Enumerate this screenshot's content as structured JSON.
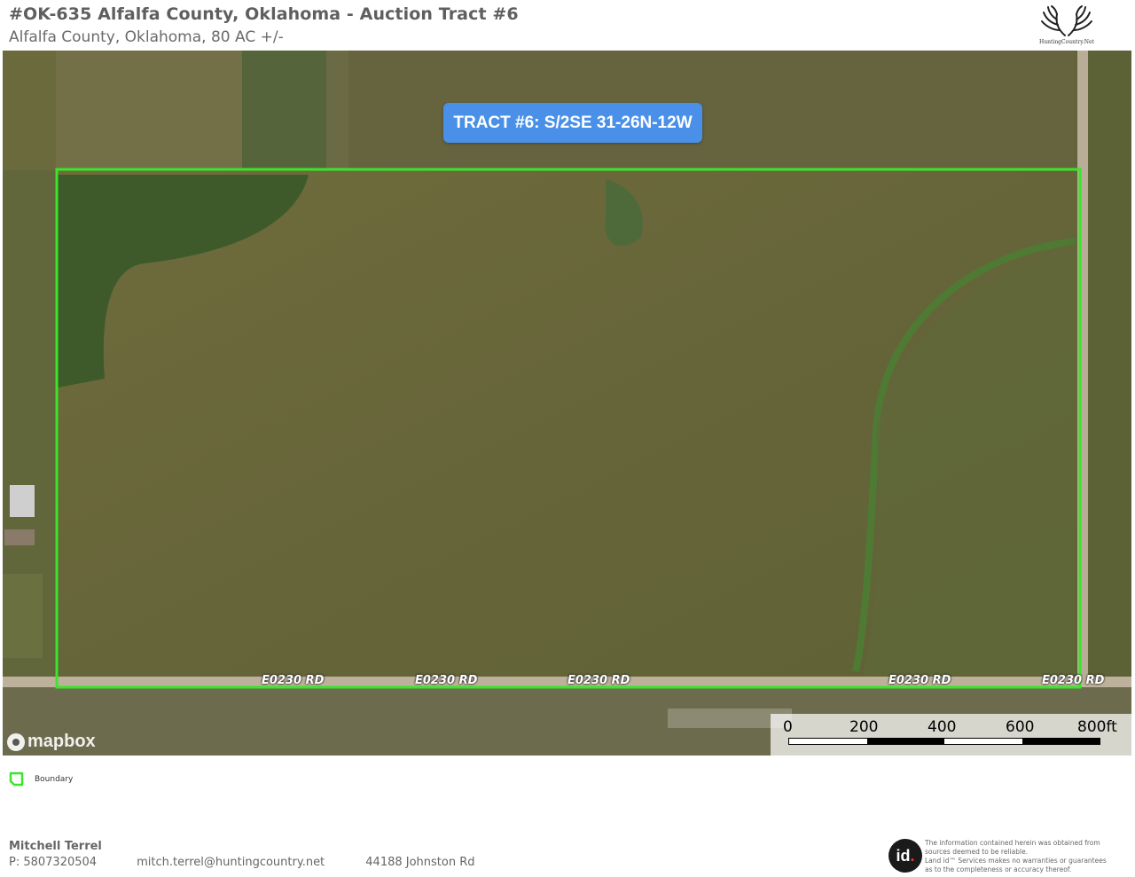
{
  "header": {
    "title": "#OK-635 Alfalfa County, Oklahoma - Auction Tract #6",
    "subtitle": "Alfalfa County, Oklahoma, 80 AC +/-"
  },
  "logo": {
    "text": "HuntingCountry.Net",
    "icon": "antlers-icon"
  },
  "map": {
    "tract_label": "TRACT #6: S/2SE 31-26N-12W",
    "road_labels": [
      "E0230 RD",
      "E0230 RD",
      "E0230 RD",
      "E0230 RD",
      "E0230 RD"
    ],
    "attribution": "mapbox",
    "boundary_color": "#39e62a",
    "scale": {
      "ticks": [
        "0",
        "200",
        "400",
        "600",
        "800ft"
      ]
    }
  },
  "legend": {
    "items": [
      {
        "label": "Boundary",
        "icon": "boundary-icon",
        "color": "#39e62a"
      }
    ]
  },
  "footer": {
    "name": "Mitchell Terrel",
    "phone": "P: 5807320504",
    "email": "mitch.terrel@huntingcountry.net",
    "address": "44188 Johnston Rd"
  },
  "disclaimer": {
    "badge": "id",
    "badge_dot": ".",
    "lines": [
      "The information contained herein was obtained from",
      "sources deemed to be reliable.",
      "Land id™ Services makes no warranties or guarantees",
      "as to the completeness or accuracy thereof."
    ]
  }
}
